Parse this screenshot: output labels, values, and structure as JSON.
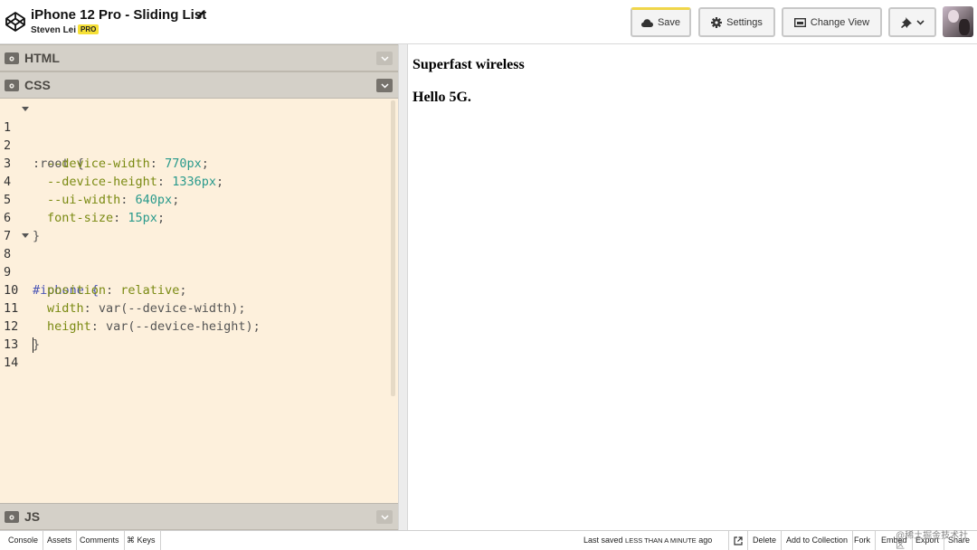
{
  "header": {
    "title": "iPhone 12 Pro - Sliding List",
    "author": "Steven Lei",
    "badge": "PRO",
    "buttons": {
      "save": "Save",
      "settings": "Settings",
      "change_view": "Change View"
    }
  },
  "panels": {
    "html": "HTML",
    "css": "CSS",
    "js": "JS"
  },
  "code": {
    "lines": [
      {
        "n": "1",
        "text": ":root {"
      },
      {
        "n": "2",
        "prop": "--device-width",
        "val": "770px"
      },
      {
        "n": "3",
        "prop": "--device-height",
        "val": "1336px"
      },
      {
        "n": "4",
        "prop": "--ui-width",
        "val": "640px"
      },
      {
        "n": "5",
        "prop": "font-size",
        "val": "15px"
      },
      {
        "n": "6",
        "text": "}"
      },
      {
        "n": "7",
        "text": ""
      },
      {
        "n": "8",
        "text": "#iphone {"
      },
      {
        "n": "9",
        "prop": "position",
        "val": "relative"
      },
      {
        "n": "10",
        "prop": "width",
        "val": "var(--device-width)"
      },
      {
        "n": "11",
        "prop": "height",
        "val": "var(--device-height)"
      },
      {
        "n": "12",
        "text": "}"
      },
      {
        "n": "13",
        "text": ""
      },
      {
        "n": "14",
        "text": ""
      }
    ]
  },
  "preview": {
    "heading1": "Superfast wireless",
    "heading2": "Hello 5G."
  },
  "footer": {
    "console": "Console",
    "assets": "Assets",
    "comments": "Comments",
    "keys": "⌘ Keys",
    "saved_prefix": "Last saved",
    "saved_time": "LESS THAN A MINUTE",
    "saved_suffix": "ago",
    "delete": "Delete",
    "add_to_collection": "Add to Collection",
    "fork": "Fork",
    "embed": "Embed",
    "export": "Export",
    "share": "Share",
    "watermark": "@稀土掘金技术社区"
  },
  "colors": {
    "editor_bg": "#fdf0dc",
    "panel_bar": "#d4d0c8",
    "save_accent": "#f0d64a",
    "pro_badge": "#f6e036",
    "css_property": "#7a8a12",
    "css_number": "#2a9a8c",
    "css_selector_id": "#4a55b5"
  }
}
